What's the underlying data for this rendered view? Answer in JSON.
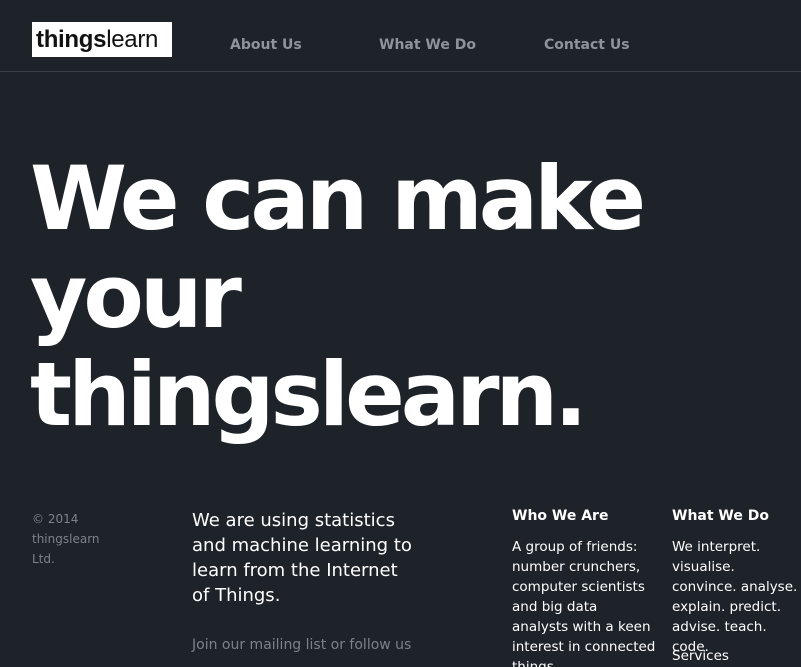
{
  "header": {
    "logo_bold": "things",
    "logo_light": "learn",
    "nav": [
      {
        "label": "About Us"
      },
      {
        "label": "What We Do"
      },
      {
        "label": "Contact Us"
      }
    ]
  },
  "hero": {
    "line1": "We can make",
    "line2": "your",
    "line3": "thingslearn."
  },
  "footer": {
    "copyright": "© 2014 thingslearn Ltd.",
    "intro": "We are using statistics and machine learning to learn from the Internet of Things.",
    "mailing": "Join our mailing list or follow us",
    "who_title": "Who We Are",
    "who_text": "A group of friends: number crunchers, computer scientists and big data analysts with a keen interest in connected things.",
    "what_title": "What We Do",
    "what_text": "We interpret. visualise. convince. analyse. explain. predict. advise. teach. code.",
    "what_sub": "Services"
  },
  "colors": {
    "background": "#1e2229",
    "nav_text": "#8f949b",
    "muted_text": "#7d828a",
    "logo_bg": "#ffffff"
  }
}
